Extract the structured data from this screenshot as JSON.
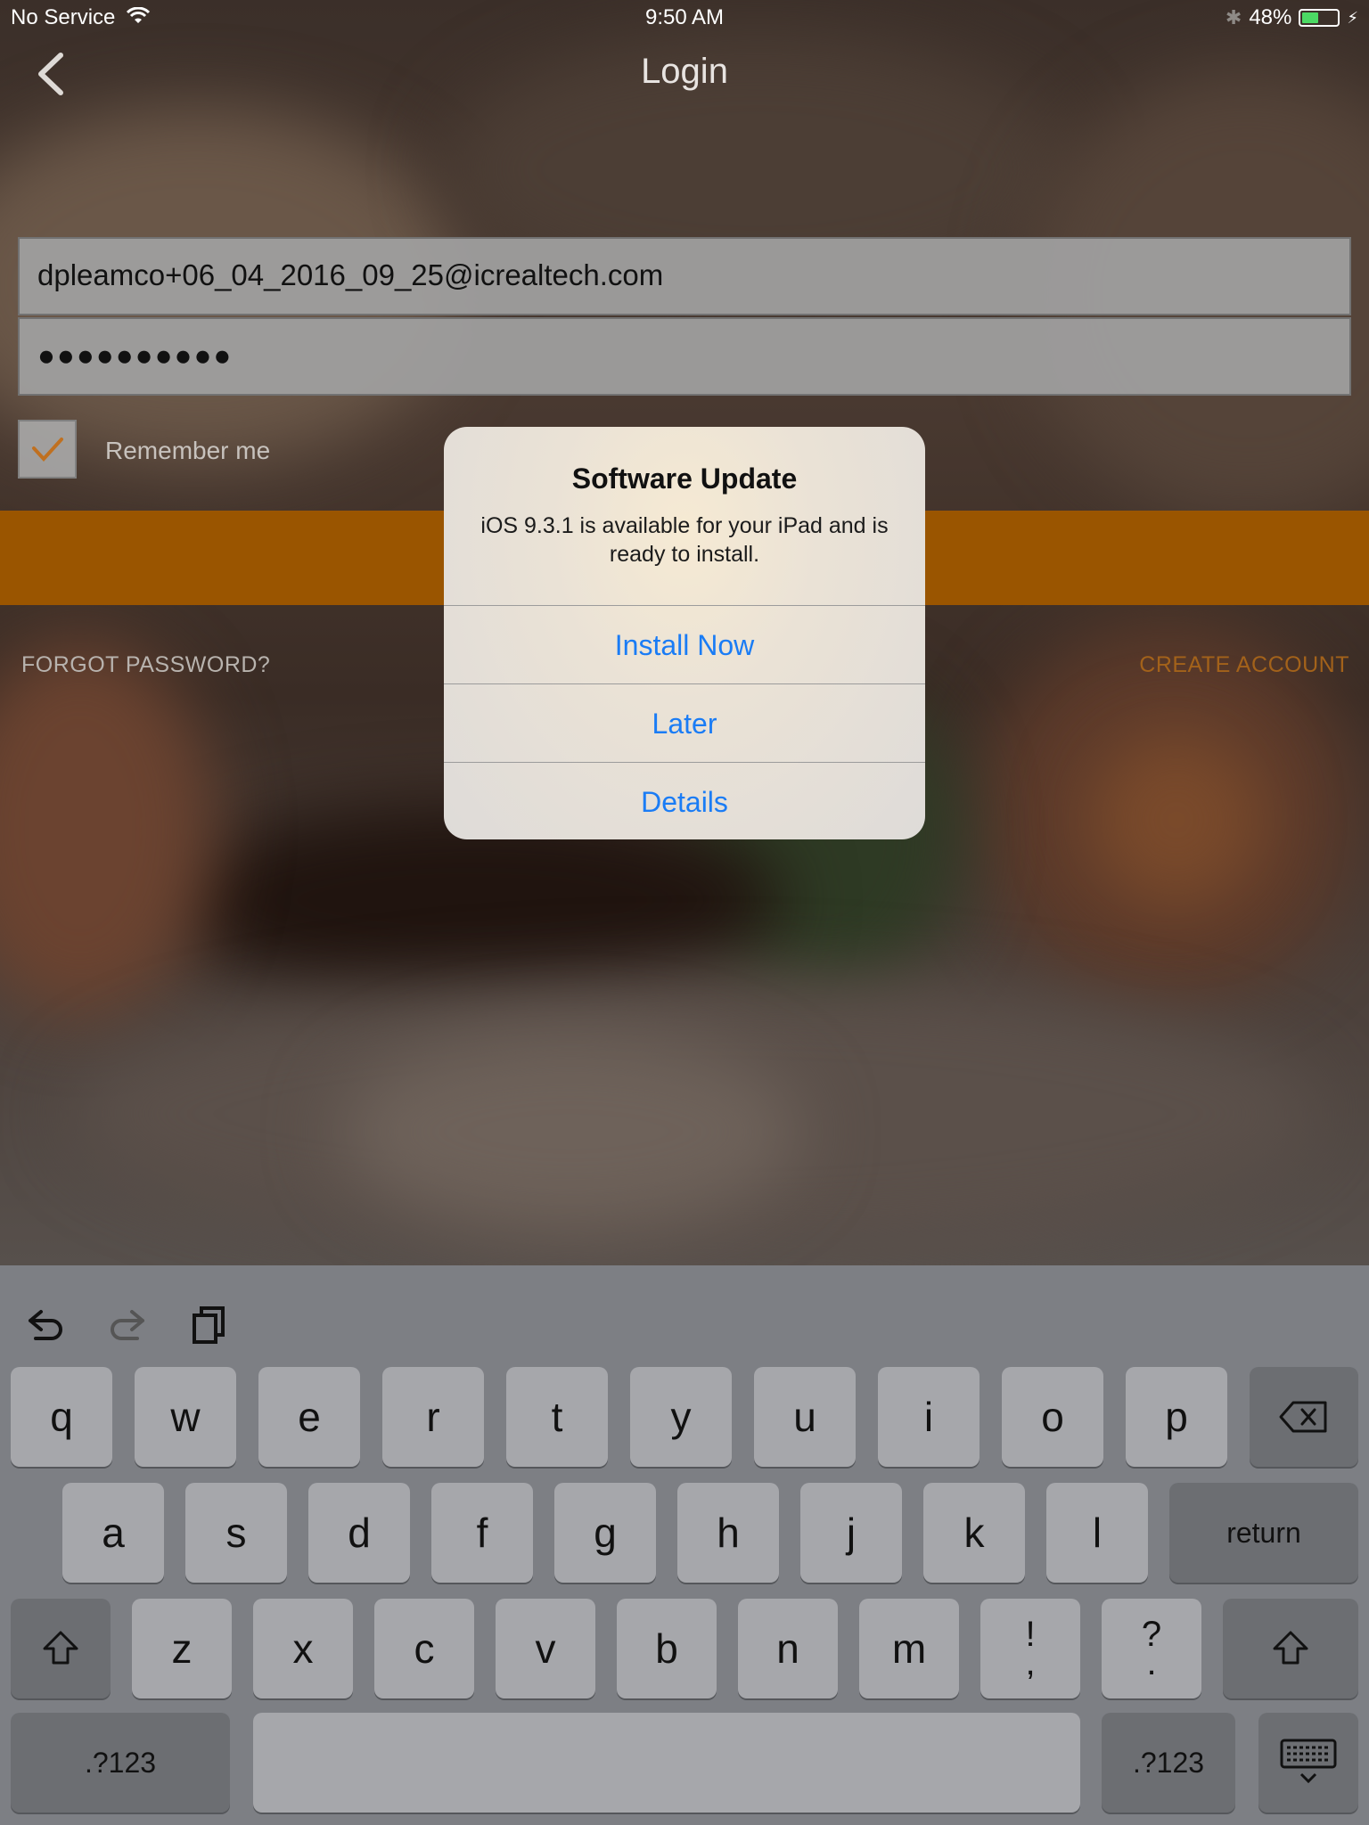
{
  "status_bar": {
    "carrier": "No Service",
    "time": "9:50 AM",
    "battery_percent": "48%",
    "battery_level": 0.48
  },
  "nav": {
    "title": "Login",
    "back_icon": "chevron-left-icon"
  },
  "form": {
    "email_value": "dpleamco+06_04_2016_09_25@icrealtech.com",
    "password_value": "●●●●●●●●●●",
    "remember_label": "Remember me",
    "remember_checked": true,
    "forgot_label": "FORGOT PASSWORD?",
    "create_label": "CREATE ACCOUNT",
    "accent_color": "#9a5500"
  },
  "alert": {
    "title": "Software Update",
    "message": "iOS 9.3.1 is available for your iPad and is ready to install.",
    "buttons": {
      "install": "Install Now",
      "later": "Later",
      "details": "Details"
    },
    "button_color": "#1a7cf5"
  },
  "keyboard": {
    "row1": [
      "q",
      "w",
      "e",
      "r",
      "t",
      "y",
      "u",
      "i",
      "o",
      "p"
    ],
    "row2": [
      "a",
      "s",
      "d",
      "f",
      "g",
      "h",
      "j",
      "k",
      "l"
    ],
    "row3": [
      "z",
      "x",
      "c",
      "v",
      "b",
      "n",
      "m"
    ],
    "punct1": [
      "!",
      ","
    ],
    "punct2": [
      "?",
      "."
    ],
    "return_label": "return",
    "numbers_label": ".?123",
    "toolbar_icons": [
      "undo-icon",
      "redo-icon",
      "paste-icon"
    ]
  }
}
